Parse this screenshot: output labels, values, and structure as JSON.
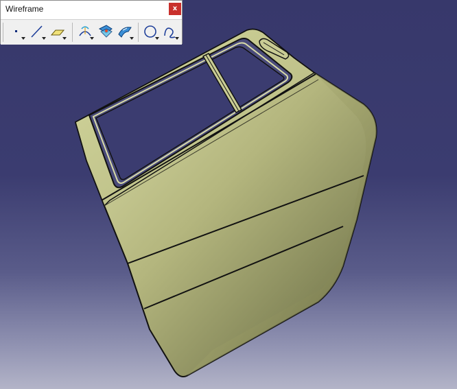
{
  "toolbar": {
    "title": "Wireframe",
    "close_label": "x",
    "tools": [
      {
        "icon": "point-icon"
      },
      {
        "icon": "line-icon"
      },
      {
        "icon": "plane-icon"
      },
      {
        "icon": "projection-icon"
      },
      {
        "icon": "intersection-icon"
      },
      {
        "icon": "offset-icon"
      },
      {
        "icon": "circle-icon"
      },
      {
        "icon": "spline-icon"
      }
    ]
  },
  "viewport": {
    "object": "car-door-model",
    "background_top": "#37386b",
    "background_bottom": "#b3b4c8",
    "surface_color": "#c8cc92",
    "edge_color": "#111111"
  }
}
